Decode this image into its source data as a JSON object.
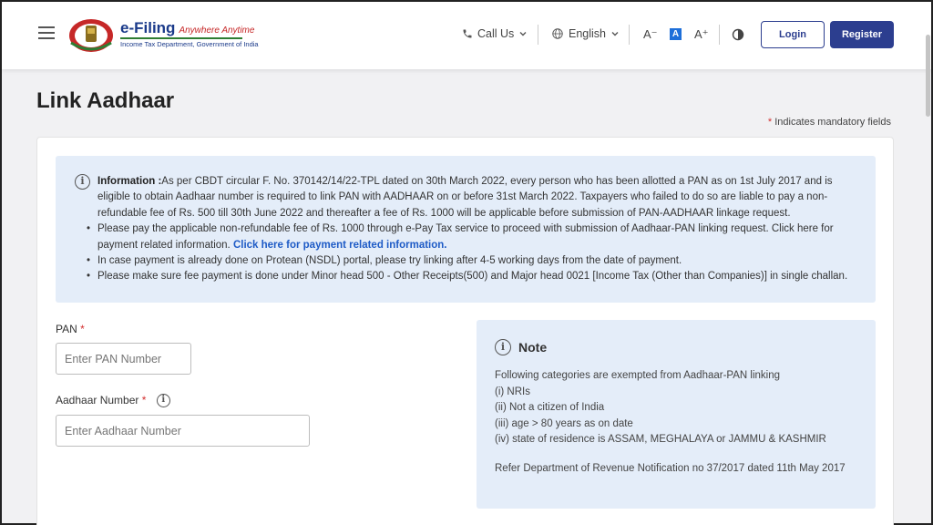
{
  "header": {
    "logo": {
      "title": "e-Filing",
      "tagline": "Anywhere Anytime",
      "subtitle": "Income Tax Department, Government of India"
    },
    "call_us": "Call Us",
    "language": "English",
    "font_decrease": "A⁻",
    "font_normal": "A",
    "font_increase": "A⁺",
    "login": "Login",
    "register": "Register"
  },
  "page": {
    "title": "Link Aadhaar",
    "mandatory_star": "*",
    "mandatory_text": "Indicates mandatory fields"
  },
  "info": {
    "heading": "Information :",
    "intro": "As per CBDT circular F. No. 370142/14/22-TPL dated on 30th March 2022, every person who has been allotted a PAN as on 1st July 2017 and is eligible to obtain Aadhaar number is required to link PAN with AADHAAR on or before 31st March 2022. Taxpayers who failed to do so are liable to pay a non-refundable fee of Rs. 500 till 30th June 2022 and thereafter a fee of Rs. 1000 will be applicable before submission of PAN-AADHAAR linkage request.",
    "bullet1": "Please pay the applicable non-refundable fee of Rs. 1000 through e-Pay Tax service to proceed with submission of Aadhaar-PAN linking request. Click here for payment related information.",
    "bullet1_link": "Click here for payment related information.",
    "bullet2": "In case payment is already done on Protean (NSDL) portal, please try linking after 4-5 working days from the date of payment.",
    "bullet3": "Please make sure fee payment is done under Minor head 500 - Other Receipts(500) and Major head 0021 [Income Tax (Other than Companies)] in single challan."
  },
  "form": {
    "pan_label": "PAN",
    "pan_placeholder": "Enter PAN Number",
    "aadhaar_label": "Aadhaar Number",
    "aadhaar_placeholder": "Enter Aadhaar Number",
    "required_star": "*"
  },
  "note": {
    "title": "Note",
    "line0": "Following categories are exempted from Aadhaar-PAN linking",
    "line1": "(i) NRIs",
    "line2": "(ii) Not a citizen of India",
    "line3": "(iii) age > 80 years as on date",
    "line4": "(iv) state of residence is ASSAM, MEGHALAYA or JAMMU & KASHMIR",
    "footer": "Refer Department of Revenue Notification no 37/2017 dated 11th May 2017"
  },
  "colors": {
    "primary": "#2c3e8f",
    "info_bg": "#e4edf9",
    "link": "#1e5bc6",
    "required": "#d32f2f"
  }
}
